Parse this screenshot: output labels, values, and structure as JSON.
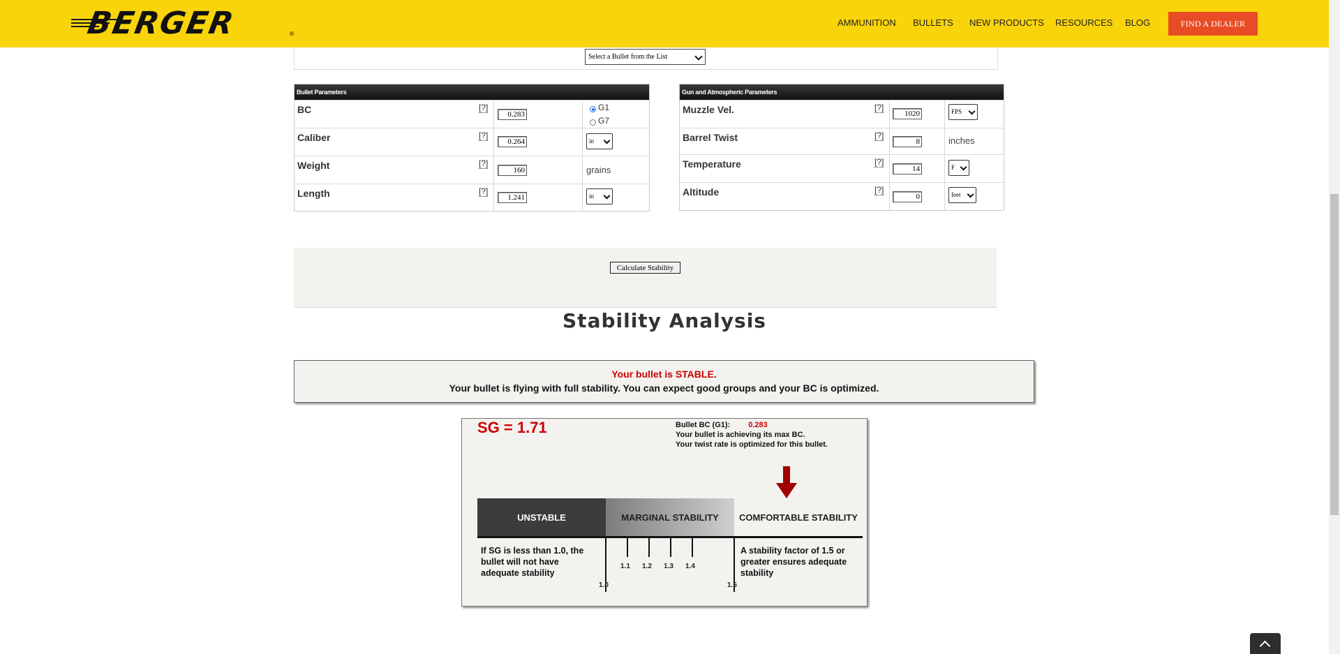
{
  "header": {
    "logo": "BERGER",
    "nav": [
      "AMMUNITION",
      "BULLETS",
      "NEW PRODUCTS",
      "RESOURCES",
      "BLOG"
    ],
    "dealer_button": "FIND A DEALER",
    "colors": {
      "bar": "#f9d40a",
      "dealer": "#e84c26"
    }
  },
  "bullet_select": {
    "value": "Select a Bullet from the List"
  },
  "bullet_params": {
    "title": "Bullet Parameters",
    "rows": [
      {
        "label": "BC",
        "help": "[?]",
        "value": "0.283"
      },
      {
        "label": "Caliber",
        "help": "[?]",
        "value": "0.264",
        "unit": "in"
      },
      {
        "label": "Weight",
        "help": "[?]",
        "value": "160",
        "unit_text": "grains"
      },
      {
        "label": "Length",
        "help": "[?]",
        "value": "1.241",
        "unit": "in"
      }
    ],
    "bc_options": [
      {
        "label": "G1",
        "selected": true
      },
      {
        "label": "G7",
        "selected": false
      }
    ]
  },
  "gun_params": {
    "title": "Gun and Atmospheric Parameters",
    "rows": [
      {
        "label": "Muzzle Vel.",
        "help": "[?]",
        "value": "1020",
        "unit": "FPS"
      },
      {
        "label": "Barrel Twist",
        "help": "[?]",
        "value": "8",
        "unit_text": "inches"
      },
      {
        "label": "Temperature",
        "help": "[?]",
        "value": "14",
        "unit": "F"
      },
      {
        "label": "Altitude",
        "help": "[?]",
        "value": "0",
        "unit": "feet"
      }
    ]
  },
  "calculate_button": "Calculate Stability",
  "analysis_title": "Stability Analysis",
  "result": {
    "status": "Your bullet is STABLE.",
    "message": "Your bullet is flying with full stability. You can expect good groups and your BC is optimized."
  },
  "stability_chart": {
    "sg_label": "SG = 1.71",
    "bc_label": "Bullet BC (G1):",
    "bc_value": "0.283",
    "line2": "Your bullet is achieving its max BC.",
    "line3": "Your twist rate is optimized for this bullet.",
    "bands": [
      "UNSTABLE",
      "MARGINAL STABILITY",
      "COMFORTABLE STABILITY"
    ],
    "ticks": [
      "1.0",
      "1.1",
      "1.2",
      "1.3",
      "1.4",
      "1.5"
    ],
    "unstable_note": "If SG is less than 1.0, the bullet will not have adequate stability",
    "comfortable_note": "A stability factor of 1.5 or greater ensures adequate stability",
    "sg_value": 1.71,
    "accent": "#c00000"
  }
}
